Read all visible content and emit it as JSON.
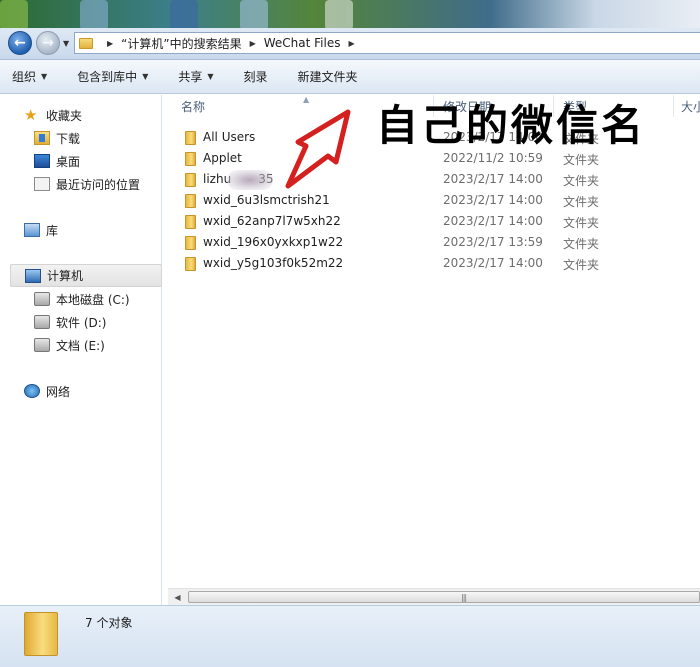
{
  "address": {
    "crumbs": [
      "“计算机”中的搜索结果",
      "WeChat Files"
    ]
  },
  "toolbar": {
    "organize": "组织",
    "include_library": "包含到库中",
    "share": "共享",
    "burn": "刻录",
    "new_folder": "新建文件夹"
  },
  "nav": {
    "favorites": "收藏夹",
    "downloads": "下载",
    "desktop": "桌面",
    "recent": "最近访问的位置",
    "libraries": "库",
    "computer": "计算机",
    "drive_c": "本地磁盘 (C:)",
    "drive_d": "软件 (D:)",
    "drive_e": "文档 (E:)",
    "network": "网络"
  },
  "columns": {
    "name": "名称",
    "date": "修改日期",
    "type": "类型",
    "size": "大小"
  },
  "files": [
    {
      "name": "All Users",
      "date": "2023/2/17 14:00",
      "type": "文件夹"
    },
    {
      "name": "Applet",
      "date": "2022/11/2 10:59",
      "type": "文件夹"
    },
    {
      "name": "lizhu",
      "name_suffix": "35",
      "date": "2023/2/17 14:00",
      "type": "文件夹"
    },
    {
      "name": "wxid_6u3lsmctrish21",
      "date": "2023/2/17 14:00",
      "type": "文件夹"
    },
    {
      "name": "wxid_62anp7l7w5xh22",
      "date": "2023/2/17 14:00",
      "type": "文件夹"
    },
    {
      "name": "wxid_196x0yxkxp1w22",
      "date": "2023/2/17 13:59",
      "type": "文件夹"
    },
    {
      "name": "wxid_y5g103f0k52m22",
      "date": "2023/2/17 14:00",
      "type": "文件夹"
    }
  ],
  "status": {
    "count": "7 个对象"
  },
  "annotation": {
    "text": "自己的微信名",
    "arrow_color": "#d4201f"
  }
}
